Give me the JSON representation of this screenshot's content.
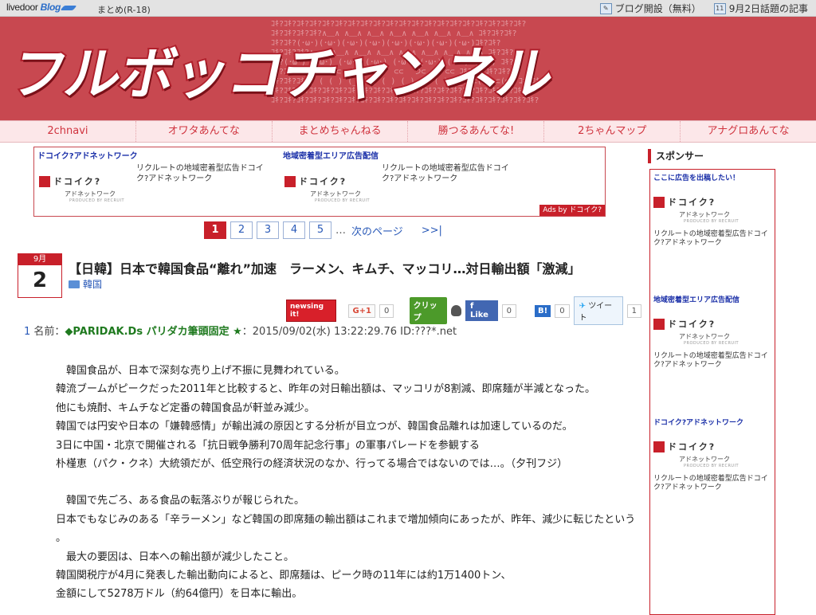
{
  "topbar": {
    "logo_text": "livedoor",
    "logo_blog": "Blog",
    "matome": "まとめ(R-18)",
    "open_blog": "ブログ開設（無料）",
    "calendar_day": "11",
    "topic": "9月2日話題の記事"
  },
  "banner": {
    "title": "フルボッコチャンネル",
    "pattern_text": "ｺｷ?ｺｷ?ｺｷ?ｺｷ?ｺｷ?ｺｷ?ｺｷ?ｺｷ?ｺｷ?ｺｷ?ｺｷ?ｺｷ?ｺｷ?ｺｷ?ｺｷ?ｺｷ?ｺｷ?ｺｷ?ｺｷ?ｺｷ?\nｺｷ?ｺｷ?ｺｷ?ｺｷ?∧＿∧ ∧＿∧ ∧＿∧ ∧＿∧ ∧＿∧ ∧＿∧ ∧＿∧ ｺｷ?ｺｷ?ｺｷ?\nｺｷ?ｺｷ?(･ω･)(･ω･)(･ω･)(･ω･)(･ω･)(･ω･)(･ω･)(･ω･)ｺｷ?ｺｷ?\nｺｷ?ｺｷ?ｺｷ?∧＿∧ ∧＿∧ ∧＿∧ ∧＿∧ ∧＿∧ ∧＿∧ ∧＿∧ ∧＿∧ ｺｷ?ｺｷ?\nｺｷ?(･ω･) (･ω･) (･ω･) (･ω･) (･ω･) (･ω･) (･ω･) (･ω･) ｺｷ?\nｺｷ?ｺｷ?(  つ⊂ つ⊂  ) ⊂⊂ ⊂⊂  ⊂⊂  つ⊂  ) ⊂⊂ ｺｷ?ｺｷ?ｺｷ?ｺｷ?\nｺｷ?ｺｷ?ｺｷ?( ( ( ) (_)  ( ( ) (_)  ( ( ) (_) ⊂(ω･ ⊂(ω･ ｺｷ?ｺｷ?\nｺｷ?ｺｷ?ｺｷ?ｺｷ?ｺｷ?ｺｷ?ｺｷ?ｺｷ?ｺｷ?ｺｷ?ｺｷ?ｺｷ?ｺｷ?ｺｷ?ｺｷ?ｺｷ?ｺｷ?ｺｷ?ｺｷ?ｺｷ?\nｺｷ?ｺｷ?ｺｷ?ｺｷ?ｺｷ?ｺｷ?ｺｷ?ｺｷ?ｺｷ?ｺｷ?ｺｷ?ｺｷ?ｺｷ?ｺｷ?ｺｷ?ｺｷ?ｺｷ?ｺｷ?ｺｷ?ｺｷ?ｺｷ?"
  },
  "nav": [
    "2chnavi",
    "オワタあんてな",
    "まとめちゃんねる",
    "勝つるあんてな!",
    "2ちゃんマップ",
    "アナグロあんてな"
  ],
  "ads": {
    "left_title": "ドコイク?アドネットワーク",
    "right_title": "地域密着型エリア広告配信",
    "text": "リクルートの地域密着型広告ドコイク?アドネットワーク",
    "logo_kana": "ドコイク?",
    "logo_sub": "アドネットワーク",
    "logo_sub2": "PRODUCED BY RECRUIT",
    "ads_by": "Ads by ドコイク?"
  },
  "pager": {
    "pages": [
      "1",
      "2",
      "3",
      "4",
      "5"
    ],
    "ellipsis": "…",
    "next": "次のページ",
    "last": ">>|"
  },
  "post": {
    "month": "9月",
    "day": "2",
    "title": "【日韓】日本で韓国食品“離れ”加速　ラーメン、キムチ、マッコリ…対日輸出額「激減」",
    "category": "韓国"
  },
  "social": {
    "newsing": "newsing it!",
    "gplus": "G+1",
    "gplus_count": "0",
    "clip": "クリップ",
    "fb_like": "Like",
    "fb_count": "0",
    "hatena": "B!",
    "hatena_count": "0",
    "tweet": "ツイート",
    "tweet_count": "1"
  },
  "res": {
    "num": "1",
    "name_label": "名前：",
    "name": "◆PARIDAK.Ds パリダカ筆頭固定 ★",
    "meta": "：2015/09/02(水) 13:22:29.76 ID:???*.net"
  },
  "body": {
    "p1": "　韓国食品が、日本で深刻な売り上げ不振に見舞われている。",
    "p2": "韓流ブームがピークだった2011年と比較すると、昨年の対日輸出額は、マッコリが8割減、即席麺が半減となった。",
    "p3": "他にも焼酎、キムチなど定番の韓国食品が軒並み減少。",
    "p4": "韓国では円安や日本の「嫌韓感情」が輸出減の原因とする分析が目立つが、韓国食品離れは加速しているのだ。",
    "p5": "3日に中国・北京で開催される「抗日戦争勝利70周年記念行事」の軍事パレードを参観する",
    "p6": "朴槿恵（パク・クネ）大統領だが、低空飛行の経済状況のなか、行ってる場合ではないのでは…。（夕刊フジ）",
    "p7": "　韓国で先ごろ、ある食品の転落ぶりが報じられた。",
    "p8": "日本でもなじみのある「辛ラーメン」など韓国の即席麺の輸出額はこれまで増加傾向にあったが、昨年、減少に転じたという",
    "p9": "。",
    "p10": "　最大の要因は、日本への輸出額が減少したこと。",
    "p11": "韓国関税庁が4月に発表した輸出動向によると、即席麺は、ピーク時の11年には約1万1400トン、",
    "p12": "金額にして5278万ドル（約64億円）を日本に輸出。"
  },
  "sidebar": {
    "heading": "スポンサー",
    "b1_title": "ここに広告を出稿したい！",
    "b2_title": "地域密着型エリア広告配信",
    "b3_title": "ドコイク?アドネットワーク",
    "text": "リクルートの地域密着型広告ドコイク?アドネットワーク"
  }
}
